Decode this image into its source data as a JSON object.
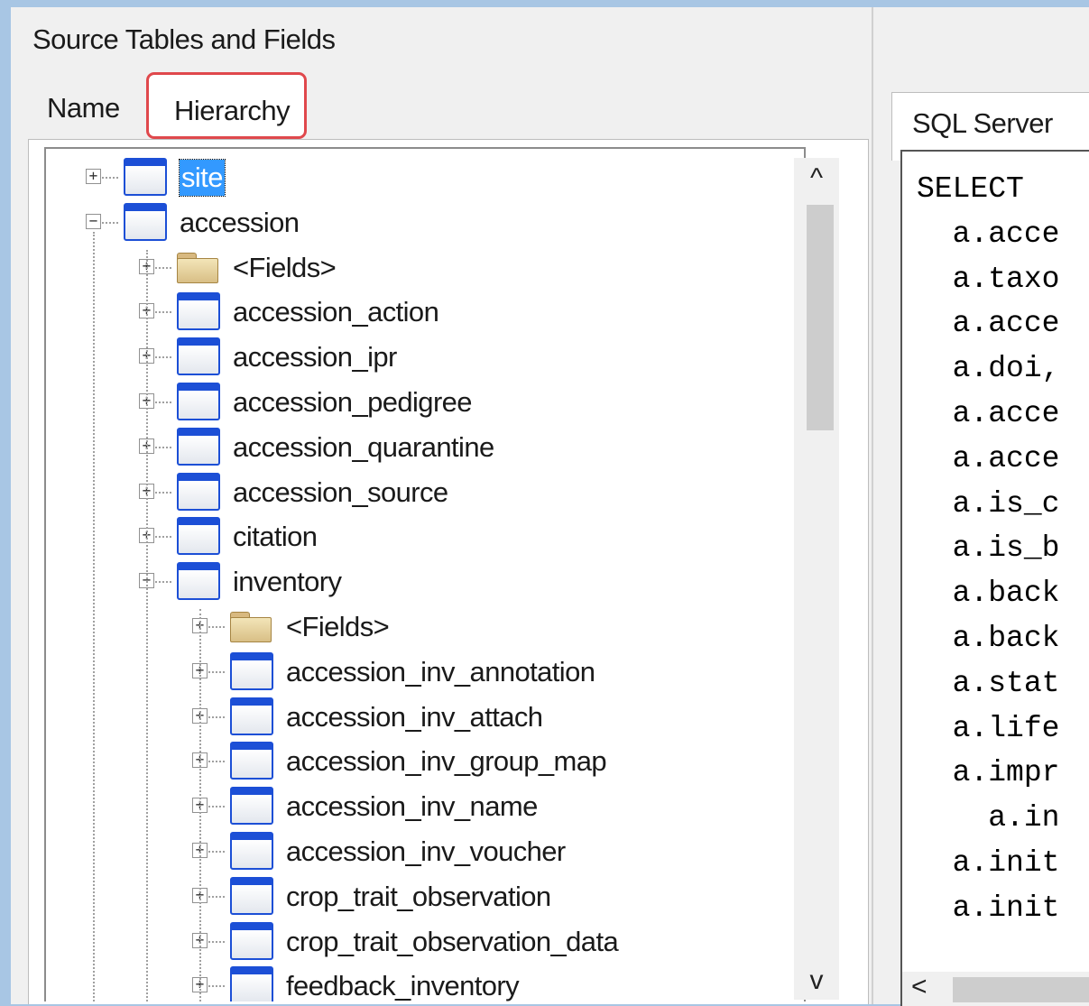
{
  "source_panel": {
    "title": "Source Tables and Fields",
    "tabs": [
      {
        "label": "Name"
      },
      {
        "label": "Hierarchy"
      }
    ]
  },
  "tree": {
    "items": [
      {
        "label": "site",
        "type": "table",
        "level": 0,
        "expanded": false,
        "selected": true
      },
      {
        "label": "accession",
        "type": "table",
        "level": 0,
        "expanded": true
      },
      {
        "label": "<Fields>",
        "type": "folder",
        "level": 1,
        "expanded": false
      },
      {
        "label": "accession_action",
        "type": "table",
        "level": 1,
        "expanded": false
      },
      {
        "label": "accession_ipr",
        "type": "table",
        "level": 1,
        "expanded": false
      },
      {
        "label": "accession_pedigree",
        "type": "table",
        "level": 1,
        "expanded": false
      },
      {
        "label": "accession_quarantine",
        "type": "table",
        "level": 1,
        "expanded": false
      },
      {
        "label": "accession_source",
        "type": "table",
        "level": 1,
        "expanded": false
      },
      {
        "label": "citation",
        "type": "table",
        "level": 1,
        "expanded": false
      },
      {
        "label": "inventory",
        "type": "table",
        "level": 1,
        "expanded": true
      },
      {
        "label": "<Fields>",
        "type": "folder",
        "level": 2,
        "expanded": false
      },
      {
        "label": "accession_inv_annotation",
        "type": "table",
        "level": 2,
        "expanded": false
      },
      {
        "label": "accession_inv_attach",
        "type": "table",
        "level": 2,
        "expanded": false
      },
      {
        "label": "accession_inv_group_map",
        "type": "table",
        "level": 2,
        "expanded": false
      },
      {
        "label": "accession_inv_name",
        "type": "table",
        "level": 2,
        "expanded": false
      },
      {
        "label": "accession_inv_voucher",
        "type": "table",
        "level": 2,
        "expanded": false
      },
      {
        "label": "crop_trait_observation",
        "type": "table",
        "level": 2,
        "expanded": false
      },
      {
        "label": "crop_trait_observation_data",
        "type": "table",
        "level": 2,
        "expanded": false
      },
      {
        "label": "feedback_inventory",
        "type": "table",
        "level": 2,
        "expanded": false
      }
    ]
  },
  "scrollbar": {
    "up_glyph": "^",
    "down_glyph": "v",
    "left_glyph": "<"
  },
  "sql_panel": {
    "tab_label": "SQL Server",
    "lines": [
      "SELECT",
      "  a.acce",
      "  a.taxo",
      "  a.acce",
      "  a.doi,",
      "  a.acce",
      "  a.acce",
      "  a.is_c",
      "  a.is_b",
      "  a.back",
      "  a.back",
      "  a.stat",
      "  a.life",
      "  a.impr",
      "    a.in",
      "  a.init",
      "  a.init"
    ]
  },
  "colors": {
    "selection": "#3399ff",
    "highlight_border": "#e0484c",
    "table_icon": "#1c4fd6"
  }
}
